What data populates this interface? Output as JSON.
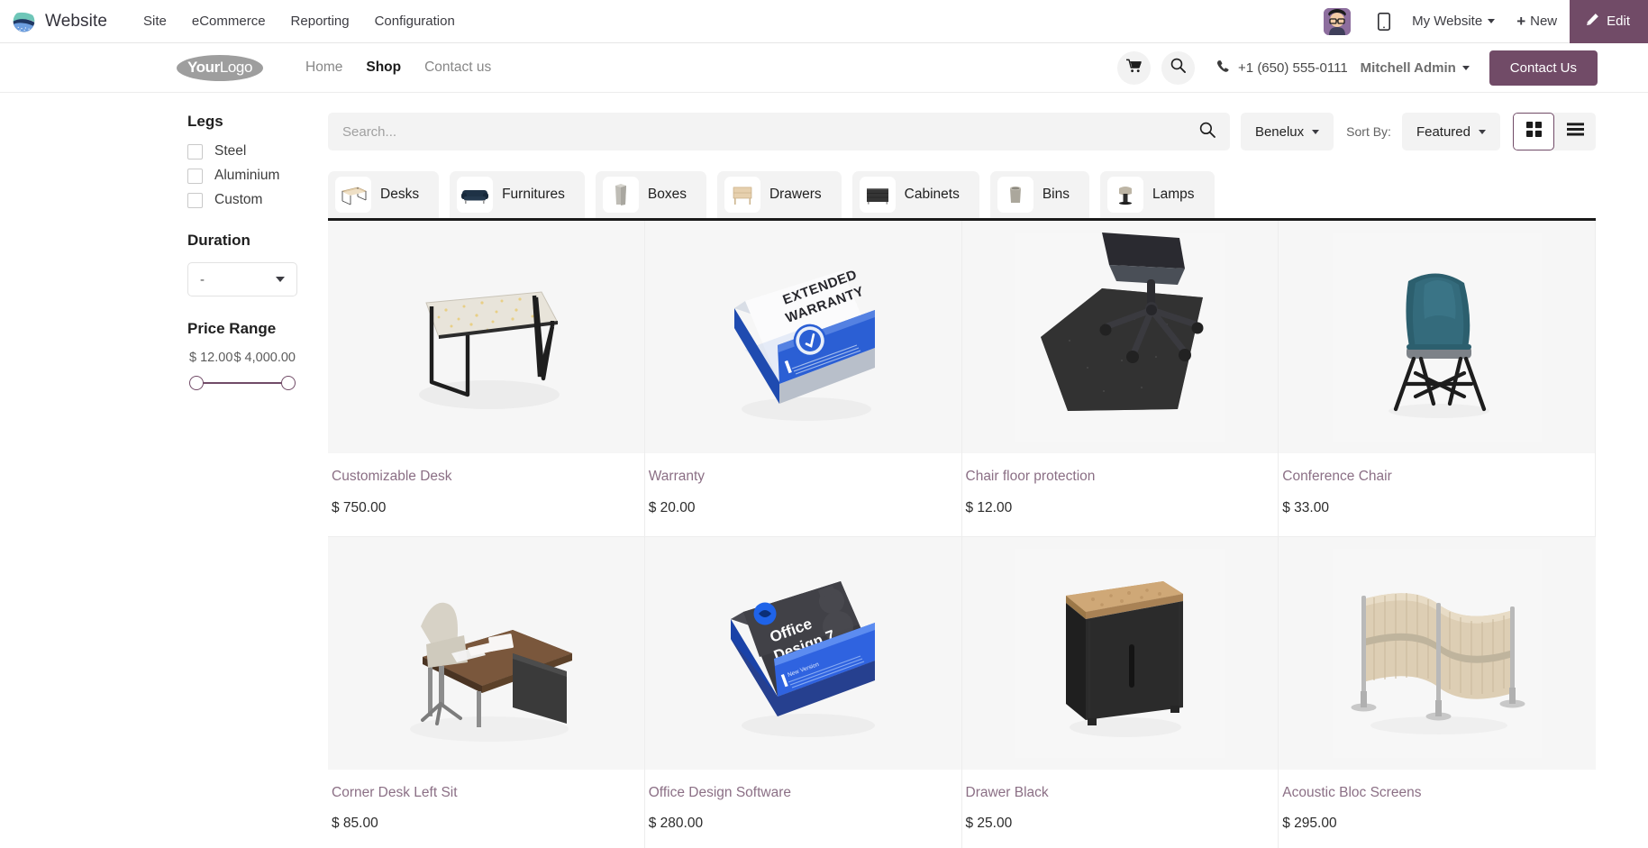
{
  "backend": {
    "brand": "Website",
    "menus": [
      "Site",
      "eCommerce",
      "Reporting",
      "Configuration"
    ],
    "website_selector": "My Website",
    "new_label": "New",
    "edit_label": "Edit",
    "accent_color": "#714b67"
  },
  "site_header": {
    "logo_bold": "Your",
    "logo_light": "Logo",
    "nav": [
      {
        "label": "Home",
        "active": false
      },
      {
        "label": "Shop",
        "active": true
      },
      {
        "label": "Contact us",
        "active": false
      }
    ],
    "phone": "+1 (650) 555-0111",
    "user": "Mitchell Admin",
    "cta": "Contact Us"
  },
  "sidebar": {
    "legs": {
      "title": "Legs",
      "options": [
        "Steel",
        "Aluminium",
        "Custom"
      ]
    },
    "duration": {
      "title": "Duration",
      "selected": "-"
    },
    "price_range": {
      "title": "Price Range",
      "min_label": "$ 12.00",
      "max_label": "$ 4,000.00",
      "min": 12,
      "max": 4000,
      "track_color": "#714b67"
    }
  },
  "toolbar": {
    "search_placeholder": "Search...",
    "search_value": "",
    "pricelist": "Benelux",
    "sort_by_label": "Sort By:",
    "sort_by_value": "Featured",
    "view_grid_active": true,
    "view_list_active": false
  },
  "categories": [
    {
      "label": "Desks",
      "icon": "desk-thumb"
    },
    {
      "label": "Furnitures",
      "icon": "sofa-thumb"
    },
    {
      "label": "Boxes",
      "icon": "box-thumb"
    },
    {
      "label": "Drawers",
      "icon": "drawer-thumb"
    },
    {
      "label": "Cabinets",
      "icon": "cabinet-thumb"
    },
    {
      "label": "Bins",
      "icon": "bin-thumb"
    },
    {
      "label": "Lamps",
      "icon": "lamp-thumb"
    }
  ],
  "products": [
    {
      "name": "Customizable Desk",
      "price": "$ 750.00",
      "image": "desk"
    },
    {
      "name": "Warranty",
      "price": "$ 20.00",
      "image": "warranty-box"
    },
    {
      "name": "Chair floor protection",
      "price": "$ 12.00",
      "image": "floor-mat"
    },
    {
      "name": "Conference Chair",
      "price": "$ 33.00",
      "image": "teal-chair"
    },
    {
      "name": "Corner Desk Left Sit",
      "price": "$ 85.00",
      "image": "corner-desk"
    },
    {
      "name": "Office Design Software",
      "price": "$ 280.00",
      "image": "software-box"
    },
    {
      "name": "Drawer Black",
      "price": "$ 25.00",
      "image": "black-drawer"
    },
    {
      "name": "Acoustic Bloc Screens",
      "price": "$ 295.00",
      "image": "acoustic-screens"
    }
  ]
}
